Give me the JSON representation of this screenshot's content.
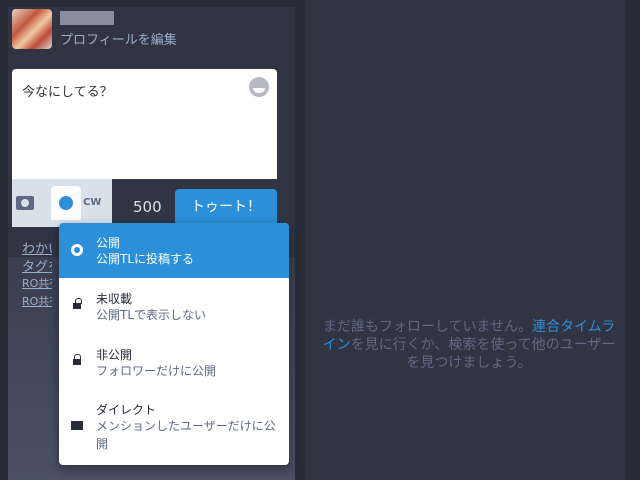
{
  "profile": {
    "edit_label": "プロフィールを編集"
  },
  "compose": {
    "placeholder": "今なにしてる？",
    "cw_label": "CW",
    "char_count": "500",
    "toot_label": "トゥート！"
  },
  "hints": [
    "わかいやすい",
    "タグをつける",
    "RO共有",
    "RO共有"
  ],
  "privacy_options": [
    {
      "title": "公開",
      "desc": "公開TLに投稿する",
      "icon": "globe-icon",
      "active": true
    },
    {
      "title": "未収載",
      "desc": "公開TLで表示しない",
      "icon": "unlock-icon",
      "active": false
    },
    {
      "title": "非公開",
      "desc": "フォロワーだけに公開",
      "icon": "lock-icon",
      "active": false
    },
    {
      "title": "ダイレクト",
      "desc": "メンションしたユーザーだけに公開",
      "icon": "envelope-icon",
      "active": false
    }
  ],
  "home": {
    "empty_before": "まだ誰もフォローしていません。",
    "link": "連合タイムライン",
    "empty_after": "を見に行くか、検索を使って他のユーザーを見つけましょう。"
  },
  "colors": {
    "accent": "#2b90d9",
    "background": "#282c37",
    "panel": "#313543"
  }
}
